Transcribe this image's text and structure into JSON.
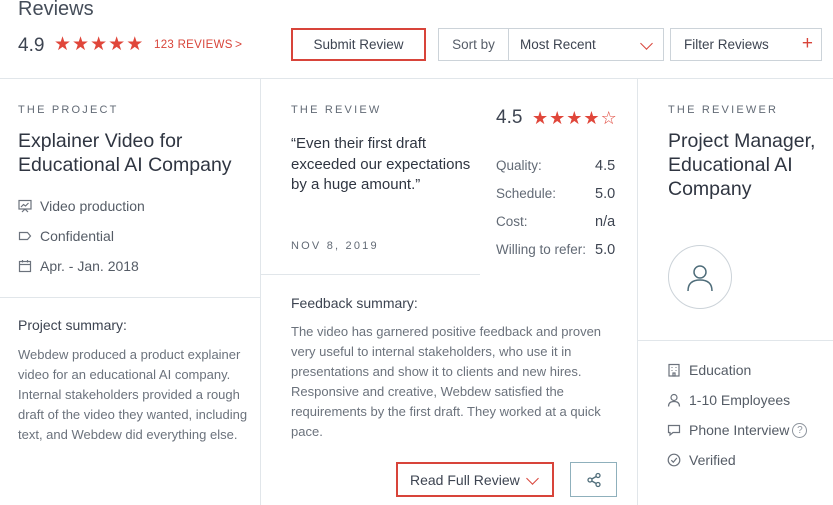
{
  "header": {
    "title": "Reviews",
    "rating": "4.9",
    "stars": 5,
    "review_count": "123 REVIEWS",
    "review_count_chevron": ">",
    "submit_label": "Submit Review",
    "sort_label": "Sort by",
    "sort_value": "Most Recent",
    "filter_label": "Filter Reviews",
    "filter_plus": "+"
  },
  "project": {
    "eyebrow": "THE PROJECT",
    "title": "Explainer Video for Educational AI Company",
    "category": "Video production",
    "budget": "Confidential",
    "dates": "Apr. - Jan. 2018",
    "summary_label": "Project summary:",
    "summary_text": "Webdew produced a product explainer video for an educational AI company. Internal stakeholders provided a rough draft of the video they wanted, including text, and Webdew did everything else."
  },
  "review": {
    "eyebrow": "THE REVIEW",
    "quote": "“Even their first draft exceeded our expectations by a huge amount.”",
    "date": "NOV 8, 2019",
    "overall": "4.5",
    "overall_stars": 4.5,
    "scores": [
      {
        "label": "Quality:",
        "value": "4.5"
      },
      {
        "label": "Schedule:",
        "value": "5.0"
      },
      {
        "label": "Cost:",
        "value": "n/a"
      },
      {
        "label": "Willing to refer:",
        "value": "5.0"
      }
    ],
    "feedback_label": "Feedback summary:",
    "feedback_text": "The video has garnered positive feedback and proven very useful to internal stakeholders, who use it in presentations and show it to clients and new hires. Responsive and creative, Webdew satisfied the requirements by the first draft. They worked at a quick pace.",
    "read_full_label": "Read Full Review"
  },
  "reviewer": {
    "eyebrow": "THE REVIEWER",
    "title": "Project Manager, Educational AI Company",
    "industry": "Education",
    "size": "1-10 Employees",
    "interview": "Phone Interview",
    "verified": "Verified",
    "help_glyph": "?"
  },
  "colors": {
    "accent": "#d8443a",
    "divider": "#e1e6ea",
    "text": "#3d4451"
  }
}
